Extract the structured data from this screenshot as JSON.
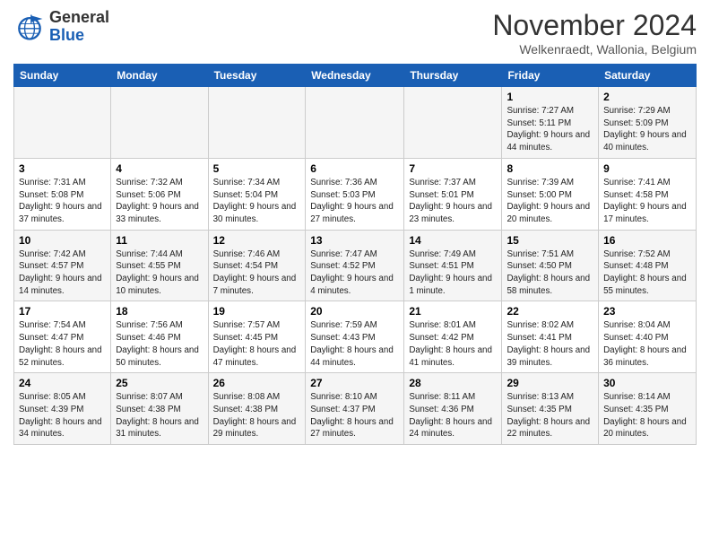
{
  "logo": {
    "general": "General",
    "blue": "Blue"
  },
  "title": "November 2024",
  "location": "Welkenraedt, Wallonia, Belgium",
  "days_of_week": [
    "Sunday",
    "Monday",
    "Tuesday",
    "Wednesday",
    "Thursday",
    "Friday",
    "Saturday"
  ],
  "weeks": [
    [
      {
        "day": "",
        "info": ""
      },
      {
        "day": "",
        "info": ""
      },
      {
        "day": "",
        "info": ""
      },
      {
        "day": "",
        "info": ""
      },
      {
        "day": "",
        "info": ""
      },
      {
        "day": "1",
        "info": "Sunrise: 7:27 AM\nSunset: 5:11 PM\nDaylight: 9 hours and 44 minutes."
      },
      {
        "day": "2",
        "info": "Sunrise: 7:29 AM\nSunset: 5:09 PM\nDaylight: 9 hours and 40 minutes."
      }
    ],
    [
      {
        "day": "3",
        "info": "Sunrise: 7:31 AM\nSunset: 5:08 PM\nDaylight: 9 hours and 37 minutes."
      },
      {
        "day": "4",
        "info": "Sunrise: 7:32 AM\nSunset: 5:06 PM\nDaylight: 9 hours and 33 minutes."
      },
      {
        "day": "5",
        "info": "Sunrise: 7:34 AM\nSunset: 5:04 PM\nDaylight: 9 hours and 30 minutes."
      },
      {
        "day": "6",
        "info": "Sunrise: 7:36 AM\nSunset: 5:03 PM\nDaylight: 9 hours and 27 minutes."
      },
      {
        "day": "7",
        "info": "Sunrise: 7:37 AM\nSunset: 5:01 PM\nDaylight: 9 hours and 23 minutes."
      },
      {
        "day": "8",
        "info": "Sunrise: 7:39 AM\nSunset: 5:00 PM\nDaylight: 9 hours and 20 minutes."
      },
      {
        "day": "9",
        "info": "Sunrise: 7:41 AM\nSunset: 4:58 PM\nDaylight: 9 hours and 17 minutes."
      }
    ],
    [
      {
        "day": "10",
        "info": "Sunrise: 7:42 AM\nSunset: 4:57 PM\nDaylight: 9 hours and 14 minutes."
      },
      {
        "day": "11",
        "info": "Sunrise: 7:44 AM\nSunset: 4:55 PM\nDaylight: 9 hours and 10 minutes."
      },
      {
        "day": "12",
        "info": "Sunrise: 7:46 AM\nSunset: 4:54 PM\nDaylight: 9 hours and 7 minutes."
      },
      {
        "day": "13",
        "info": "Sunrise: 7:47 AM\nSunset: 4:52 PM\nDaylight: 9 hours and 4 minutes."
      },
      {
        "day": "14",
        "info": "Sunrise: 7:49 AM\nSunset: 4:51 PM\nDaylight: 9 hours and 1 minute."
      },
      {
        "day": "15",
        "info": "Sunrise: 7:51 AM\nSunset: 4:50 PM\nDaylight: 8 hours and 58 minutes."
      },
      {
        "day": "16",
        "info": "Sunrise: 7:52 AM\nSunset: 4:48 PM\nDaylight: 8 hours and 55 minutes."
      }
    ],
    [
      {
        "day": "17",
        "info": "Sunrise: 7:54 AM\nSunset: 4:47 PM\nDaylight: 8 hours and 52 minutes."
      },
      {
        "day": "18",
        "info": "Sunrise: 7:56 AM\nSunset: 4:46 PM\nDaylight: 8 hours and 50 minutes."
      },
      {
        "day": "19",
        "info": "Sunrise: 7:57 AM\nSunset: 4:45 PM\nDaylight: 8 hours and 47 minutes."
      },
      {
        "day": "20",
        "info": "Sunrise: 7:59 AM\nSunset: 4:43 PM\nDaylight: 8 hours and 44 minutes."
      },
      {
        "day": "21",
        "info": "Sunrise: 8:01 AM\nSunset: 4:42 PM\nDaylight: 8 hours and 41 minutes."
      },
      {
        "day": "22",
        "info": "Sunrise: 8:02 AM\nSunset: 4:41 PM\nDaylight: 8 hours and 39 minutes."
      },
      {
        "day": "23",
        "info": "Sunrise: 8:04 AM\nSunset: 4:40 PM\nDaylight: 8 hours and 36 minutes."
      }
    ],
    [
      {
        "day": "24",
        "info": "Sunrise: 8:05 AM\nSunset: 4:39 PM\nDaylight: 8 hours and 34 minutes."
      },
      {
        "day": "25",
        "info": "Sunrise: 8:07 AM\nSunset: 4:38 PM\nDaylight: 8 hours and 31 minutes."
      },
      {
        "day": "26",
        "info": "Sunrise: 8:08 AM\nSunset: 4:38 PM\nDaylight: 8 hours and 29 minutes."
      },
      {
        "day": "27",
        "info": "Sunrise: 8:10 AM\nSunset: 4:37 PM\nDaylight: 8 hours and 27 minutes."
      },
      {
        "day": "28",
        "info": "Sunrise: 8:11 AM\nSunset: 4:36 PM\nDaylight: 8 hours and 24 minutes."
      },
      {
        "day": "29",
        "info": "Sunrise: 8:13 AM\nSunset: 4:35 PM\nDaylight: 8 hours and 22 minutes."
      },
      {
        "day": "30",
        "info": "Sunrise: 8:14 AM\nSunset: 4:35 PM\nDaylight: 8 hours and 20 minutes."
      }
    ]
  ]
}
